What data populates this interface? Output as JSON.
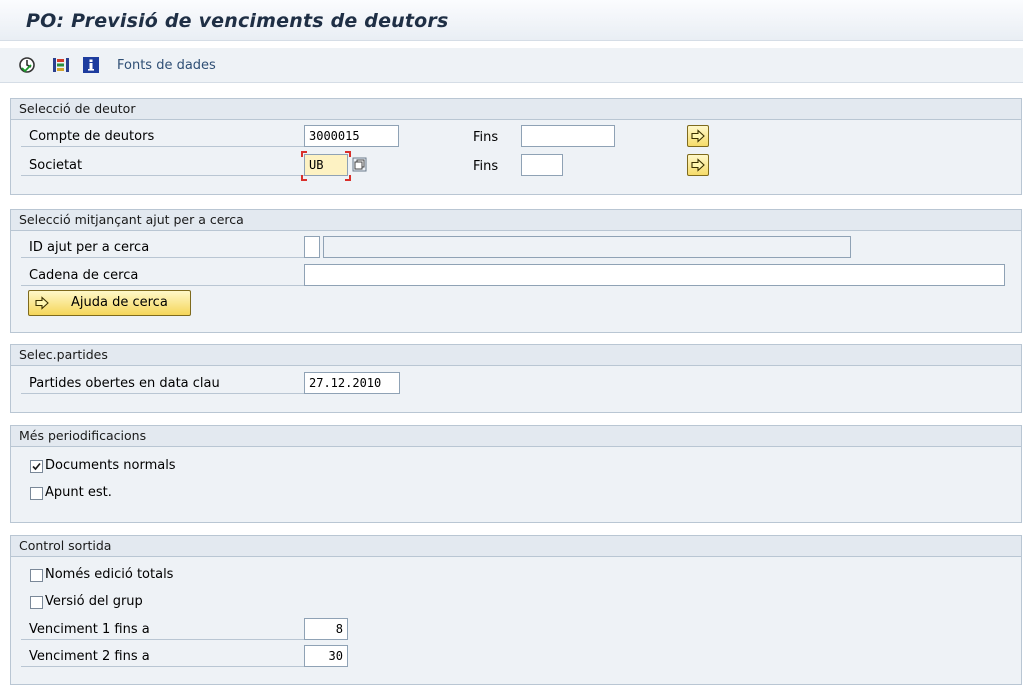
{
  "window": {
    "title": "PO: Previsió de venciments de deutors"
  },
  "toolbar": {
    "icons": [
      "execute-icon",
      "selection-options-icon",
      "info-icon"
    ],
    "data_sources_label": "Fonts de dades"
  },
  "debtor_selection": {
    "header": "Selecció de deutor",
    "account_label": "Compte de deutors",
    "account_value": "3000015",
    "account_to_label": "Fins",
    "account_to_value": "",
    "company_label": "Societat",
    "company_value": "UB",
    "company_to_label": "Fins",
    "company_to_value": ""
  },
  "search_help_selection": {
    "header": "Selecció mitjançant ajut per a cerca",
    "id_label": "ID ajut per a cerca",
    "id_value": "",
    "id_desc_value": "",
    "string_label": "Cadena de cerca",
    "string_value": "",
    "button_label": "Ajuda de cerca"
  },
  "item_selection": {
    "header": "Selec.partides",
    "open_items_label": "Partides obertes en data clau",
    "open_items_value": "27.12.2010"
  },
  "more_accruals": {
    "header": "Més periodificacions",
    "normal_docs_label": "Documents normals",
    "normal_docs_checked": true,
    "statistical_label": "Apunt est.",
    "statistical_checked": false
  },
  "output_control": {
    "header": "Control sortida",
    "totals_only_label": "Només edició totals",
    "totals_only_checked": false,
    "group_version_label": "Versió del grup",
    "group_version_checked": false,
    "due1_label": "Venciment 1 fins a",
    "due1_value": "8",
    "due2_label": "Venciment 2 fins a",
    "due2_value": "30"
  },
  "colors": {
    "background": "#eef2f6",
    "title_text": "#1f2f45",
    "button_yellow": "#f5d65a",
    "required_field": "#fdf2c3",
    "link_text": "#2f4f75"
  }
}
